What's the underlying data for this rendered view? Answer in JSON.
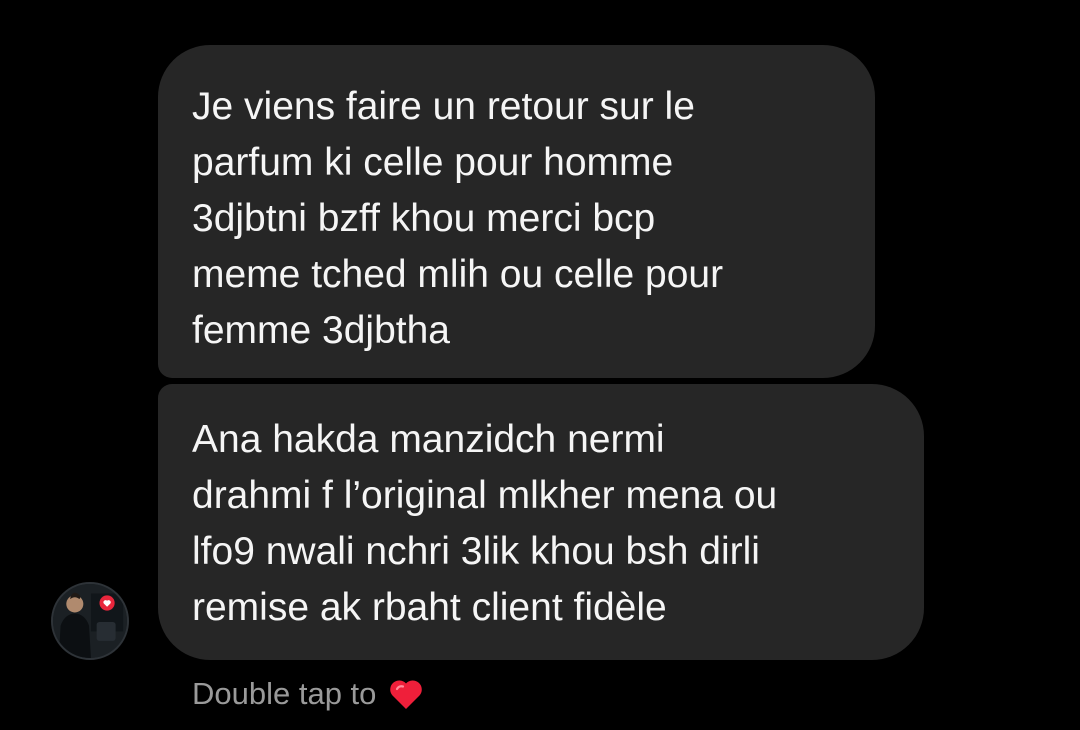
{
  "messages": [
    {
      "text": "Je viens faire un retour sur le\nparfum ki celle pour homme\n3djbtni bzff khou merci bcp\nmeme tched mlih ou celle pour\nfemme 3djbtha"
    },
    {
      "text": "Ana hakda manzidch nermi\ndrahmi f l’original mlkher mena ou\nlfo9 nwali nchri 3lik khou bsh dirli\nremise ak rbaht client fidèle"
    }
  ],
  "hint": {
    "label": "Double tap to",
    "icon": "heart-icon"
  },
  "colors": {
    "background": "#000000",
    "bubble": "#262626",
    "text": "#f5f5f5",
    "hint_text": "#9a9a9a",
    "heart": "#ef1f3a"
  }
}
